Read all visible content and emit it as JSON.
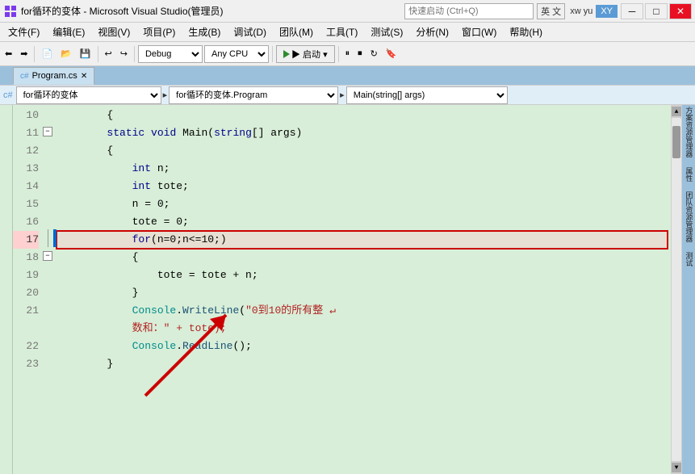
{
  "titleBar": {
    "icon": "vs-icon",
    "title": "for循环的变体 - Microsoft Visual Studio(管理员)",
    "searchPlaceholder": "快速启动 (Ctrl+Q)",
    "lang": "英 文",
    "user": "xw yu",
    "userInitials": "XY",
    "minimizeLabel": "─",
    "maximizeLabel": "□",
    "closeLabel": "✕"
  },
  "menuBar": {
    "items": [
      "文件(F)",
      "编辑(E)",
      "视图(V)",
      "项目(P)",
      "生成(B)",
      "调试(D)",
      "团队(M)",
      "工具(T)",
      "测试(S)",
      "分析(N)",
      "窗口(W)",
      "帮助(H)"
    ]
  },
  "toolbar": {
    "debugMode": "Debug",
    "cpuMode": "Any CPU",
    "startLabel": "▶ 启动 ▾",
    "undoLabel": "↩",
    "redoLabel": "↪"
  },
  "tabs": [
    {
      "label": "Program.cs",
      "active": true
    }
  ],
  "fileInfoBar": {
    "namespace": "for循环的变体",
    "class": "for循环的变体.Program",
    "method": "Main(string[] args)"
  },
  "codeLines": [
    {
      "num": 10,
      "indent": 2,
      "content": "{",
      "tokens": [
        {
          "text": "{",
          "class": "plain"
        }
      ]
    },
    {
      "num": 11,
      "indent": 3,
      "content": "    static void Main(string[] args)",
      "tokens": [
        {
          "text": "    static ",
          "class": "kw"
        },
        {
          "text": "void",
          "class": "kw"
        },
        {
          "text": " Main(",
          "class": "plain"
        },
        {
          "text": "string",
          "class": "kw"
        },
        {
          "text": "[] args)",
          "class": "plain"
        }
      ]
    },
    {
      "num": 12,
      "indent": 4,
      "content": "    {",
      "tokens": [
        {
          "text": "    {",
          "class": "plain"
        }
      ]
    },
    {
      "num": 13,
      "indent": 5,
      "content": "        int n;",
      "tokens": [
        {
          "text": "        ",
          "class": "plain"
        },
        {
          "text": "int",
          "class": "kw"
        },
        {
          "text": " n;",
          "class": "plain"
        }
      ]
    },
    {
      "num": 14,
      "indent": 5,
      "content": "        int tote;",
      "tokens": [
        {
          "text": "        ",
          "class": "plain"
        },
        {
          "text": "int",
          "class": "kw"
        },
        {
          "text": " tote;",
          "class": "plain"
        }
      ]
    },
    {
      "num": 15,
      "indent": 5,
      "content": "        n = 0;",
      "tokens": [
        {
          "text": "        n = 0;",
          "class": "plain"
        }
      ]
    },
    {
      "num": 16,
      "indent": 5,
      "content": "        tote = 0;",
      "tokens": [
        {
          "text": "        tote = 0;",
          "class": "plain"
        }
      ]
    },
    {
      "num": 17,
      "indent": 5,
      "highlight": true,
      "content": "        for(n=0;n<=10;)",
      "tokens": [
        {
          "text": "        ",
          "class": "plain"
        },
        {
          "text": "for",
          "class": "kw"
        },
        {
          "text": "(n=0;n<=10;)",
          "class": "plain"
        }
      ]
    },
    {
      "num": 18,
      "indent": 6,
      "content": "        {",
      "tokens": [
        {
          "text": "        {",
          "class": "plain"
        }
      ]
    },
    {
      "num": 19,
      "indent": 7,
      "content": "            tote = tote + n;",
      "tokens": [
        {
          "text": "            tote = tote + n;",
          "class": "plain"
        }
      ]
    },
    {
      "num": 20,
      "indent": 6,
      "content": "        }",
      "tokens": [
        {
          "text": "        }",
          "class": "plain"
        }
      ]
    },
    {
      "num": 21,
      "indent": 5,
      "content": "        Console.WriteLine(“0到10的所有整 ↵",
      "tokens": [
        {
          "text": "        ",
          "class": "plain"
        },
        {
          "text": "Console",
          "class": "cyan"
        },
        {
          "text": ".",
          "class": "plain"
        },
        {
          "text": "WriteLine",
          "class": "method-call"
        },
        {
          "text": "(“0到10的所有整 ↵",
          "class": "string"
        }
      ]
    },
    {
      "num": "",
      "indent": 5,
      "continuation": true,
      "content": "        数和：” + tote);",
      "tokens": [
        {
          "text": "        数和：” + tote);",
          "class": "string"
        }
      ]
    },
    {
      "num": 22,
      "indent": 5,
      "content": "        Console.ReadLine();",
      "tokens": [
        {
          "text": "        ",
          "class": "plain"
        },
        {
          "text": "Console",
          "class": "cyan"
        },
        {
          "text": ".",
          "class": "plain"
        },
        {
          "text": "ReadLine",
          "class": "method-call"
        },
        {
          "text": "();",
          "class": "plain"
        }
      ]
    },
    {
      "num": 23,
      "indent": 4,
      "content": "    }",
      "tokens": [
        {
          "text": "    }",
          "class": "plain"
        }
      ]
    }
  ],
  "sideLabels": [
    "方",
    "案",
    "资",
    "源",
    "管",
    "理",
    "器",
    "",
    "属",
    "性",
    "",
    "团",
    "队",
    "资",
    "源",
    "管",
    "理",
    "器"
  ],
  "rightLabels": [
    "测",
    "试"
  ]
}
